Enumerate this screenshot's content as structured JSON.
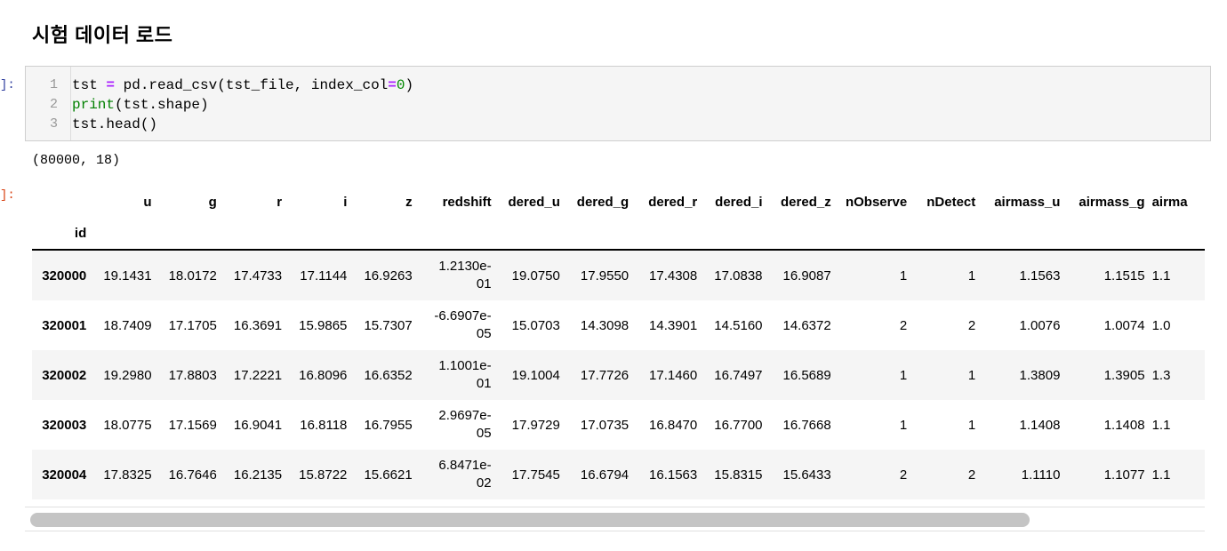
{
  "heading": "시험 데이터 로드",
  "in_prompt": "]:",
  "out_prompt": "]:",
  "code": {
    "line_numbers": [
      "1",
      "2",
      "3"
    ],
    "lines": [
      "tst = pd.read_csv(tst_file, index_col=0)",
      "print(tst.shape)",
      "tst.head()"
    ]
  },
  "stdout": "(80000, 18)",
  "table": {
    "index_name": "id",
    "columns": [
      "u",
      "g",
      "r",
      "i",
      "z",
      "redshift",
      "dered_u",
      "dered_g",
      "dered_r",
      "dered_i",
      "dered_z",
      "nObserve",
      "nDetect",
      "airmass_u",
      "airmass_g",
      "airma"
    ],
    "rows": [
      {
        "id": "320000",
        "cells": [
          "19.1431",
          "18.0172",
          "17.4733",
          "17.1144",
          "16.9263",
          "1.2130e-01",
          "19.0750",
          "17.9550",
          "17.4308",
          "17.0838",
          "16.9087",
          "1",
          "1",
          "1.1563",
          "1.1515",
          "1.1"
        ]
      },
      {
        "id": "320001",
        "cells": [
          "18.7409",
          "17.1705",
          "16.3691",
          "15.9865",
          "15.7307",
          "-6.6907e-05",
          "15.0703",
          "14.3098",
          "14.3901",
          "14.5160",
          "14.6372",
          "2",
          "2",
          "1.0076",
          "1.0074",
          "1.0"
        ]
      },
      {
        "id": "320002",
        "cells": [
          "19.2980",
          "17.8803",
          "17.2221",
          "16.8096",
          "16.6352",
          "1.1001e-01",
          "19.1004",
          "17.7726",
          "17.1460",
          "16.7497",
          "16.5689",
          "1",
          "1",
          "1.3809",
          "1.3905",
          "1.3"
        ]
      },
      {
        "id": "320003",
        "cells": [
          "18.0775",
          "17.1569",
          "16.9041",
          "16.8118",
          "16.7955",
          "2.9697e-05",
          "17.9729",
          "17.0735",
          "16.8470",
          "16.7700",
          "16.7668",
          "1",
          "1",
          "1.1408",
          "1.1408",
          "1.1"
        ]
      },
      {
        "id": "320004",
        "cells": [
          "17.8325",
          "16.7646",
          "16.2135",
          "15.8722",
          "15.6621",
          "6.8471e-02",
          "17.7545",
          "16.6794",
          "16.1563",
          "15.8315",
          "15.6433",
          "2",
          "2",
          "1.1110",
          "1.1077",
          "1.1"
        ]
      }
    ]
  }
}
